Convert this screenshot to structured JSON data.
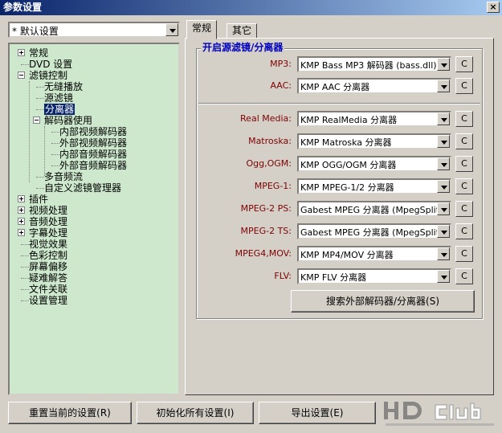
{
  "window": {
    "title": "参数设置",
    "close_label": "×"
  },
  "preset": {
    "value": "* 默认设置"
  },
  "tree": {
    "items": [
      {
        "label": "常规",
        "expander": "plus"
      },
      {
        "label": "DVD 设置",
        "expander": ""
      },
      {
        "label": "滤镜控制",
        "expander": "minus"
      },
      {
        "label": "无缝播放",
        "expander": ""
      },
      {
        "label": "源滤镜",
        "expander": ""
      },
      {
        "label": "分离器",
        "expander": "",
        "selected": true
      },
      {
        "label": "解码器使用",
        "expander": "minus"
      },
      {
        "label": "内部视频解码器",
        "expander": ""
      },
      {
        "label": "外部视频解码器",
        "expander": ""
      },
      {
        "label": "内部音频解码器",
        "expander": ""
      },
      {
        "label": "外部音频解码器",
        "expander": ""
      },
      {
        "label": "多音频流",
        "expander": ""
      },
      {
        "label": "自定义滤镜管理器",
        "expander": ""
      },
      {
        "label": "插件",
        "expander": "plus"
      },
      {
        "label": "视频处理",
        "expander": "plus"
      },
      {
        "label": "音频处理",
        "expander": "plus"
      },
      {
        "label": "字幕处理",
        "expander": "plus"
      },
      {
        "label": "视觉效果",
        "expander": ""
      },
      {
        "label": "色彩控制",
        "expander": ""
      },
      {
        "label": "屏幕偏移",
        "expander": ""
      },
      {
        "label": "疑难解答",
        "expander": ""
      },
      {
        "label": "文件关联",
        "expander": ""
      },
      {
        "label": "设置管理",
        "expander": ""
      }
    ]
  },
  "tabs": [
    {
      "label": "常规",
      "active": true
    },
    {
      "label": "其它",
      "active": false
    }
  ],
  "group": {
    "title": "开启源滤镜/分离器",
    "rows": [
      {
        "label": "MP3:",
        "value": "KMP Bass MP3 解码器 (bass.dll)"
      },
      {
        "label": "AAC:",
        "value": "KMP AAC 分离器"
      },
      {
        "label": "Real Media:",
        "value": "KMP RealMedia 分离器"
      },
      {
        "label": "Matroska:",
        "value": "KMP Matroska 分离器"
      },
      {
        "label": "Ogg,OGM:",
        "value": "KMP OGG/OGM 分离器"
      },
      {
        "label": "MPEG-1:",
        "value": "KMP MPEG-1/2 分离器"
      },
      {
        "label": "MPEG-2 PS:",
        "value": "Gabest MPEG 分离器 (MpegSplitter)"
      },
      {
        "label": "MPEG-2 TS:",
        "value": "Gabest MPEG 分离器 (MpegSplitter)"
      },
      {
        "label": "MPEG4,MOV:",
        "value": "KMP MP4/MOV 分离器"
      },
      {
        "label": "FLV:",
        "value": "KMP FLV 分离器"
      }
    ],
    "c_label": "C",
    "search_button": "搜索外部解码器/分离器(S)"
  },
  "footer": {
    "reset_label": "重置当前的设置(R)",
    "init_label": "初始化所有设置(I)",
    "export_label": "导出设置(E)"
  }
}
